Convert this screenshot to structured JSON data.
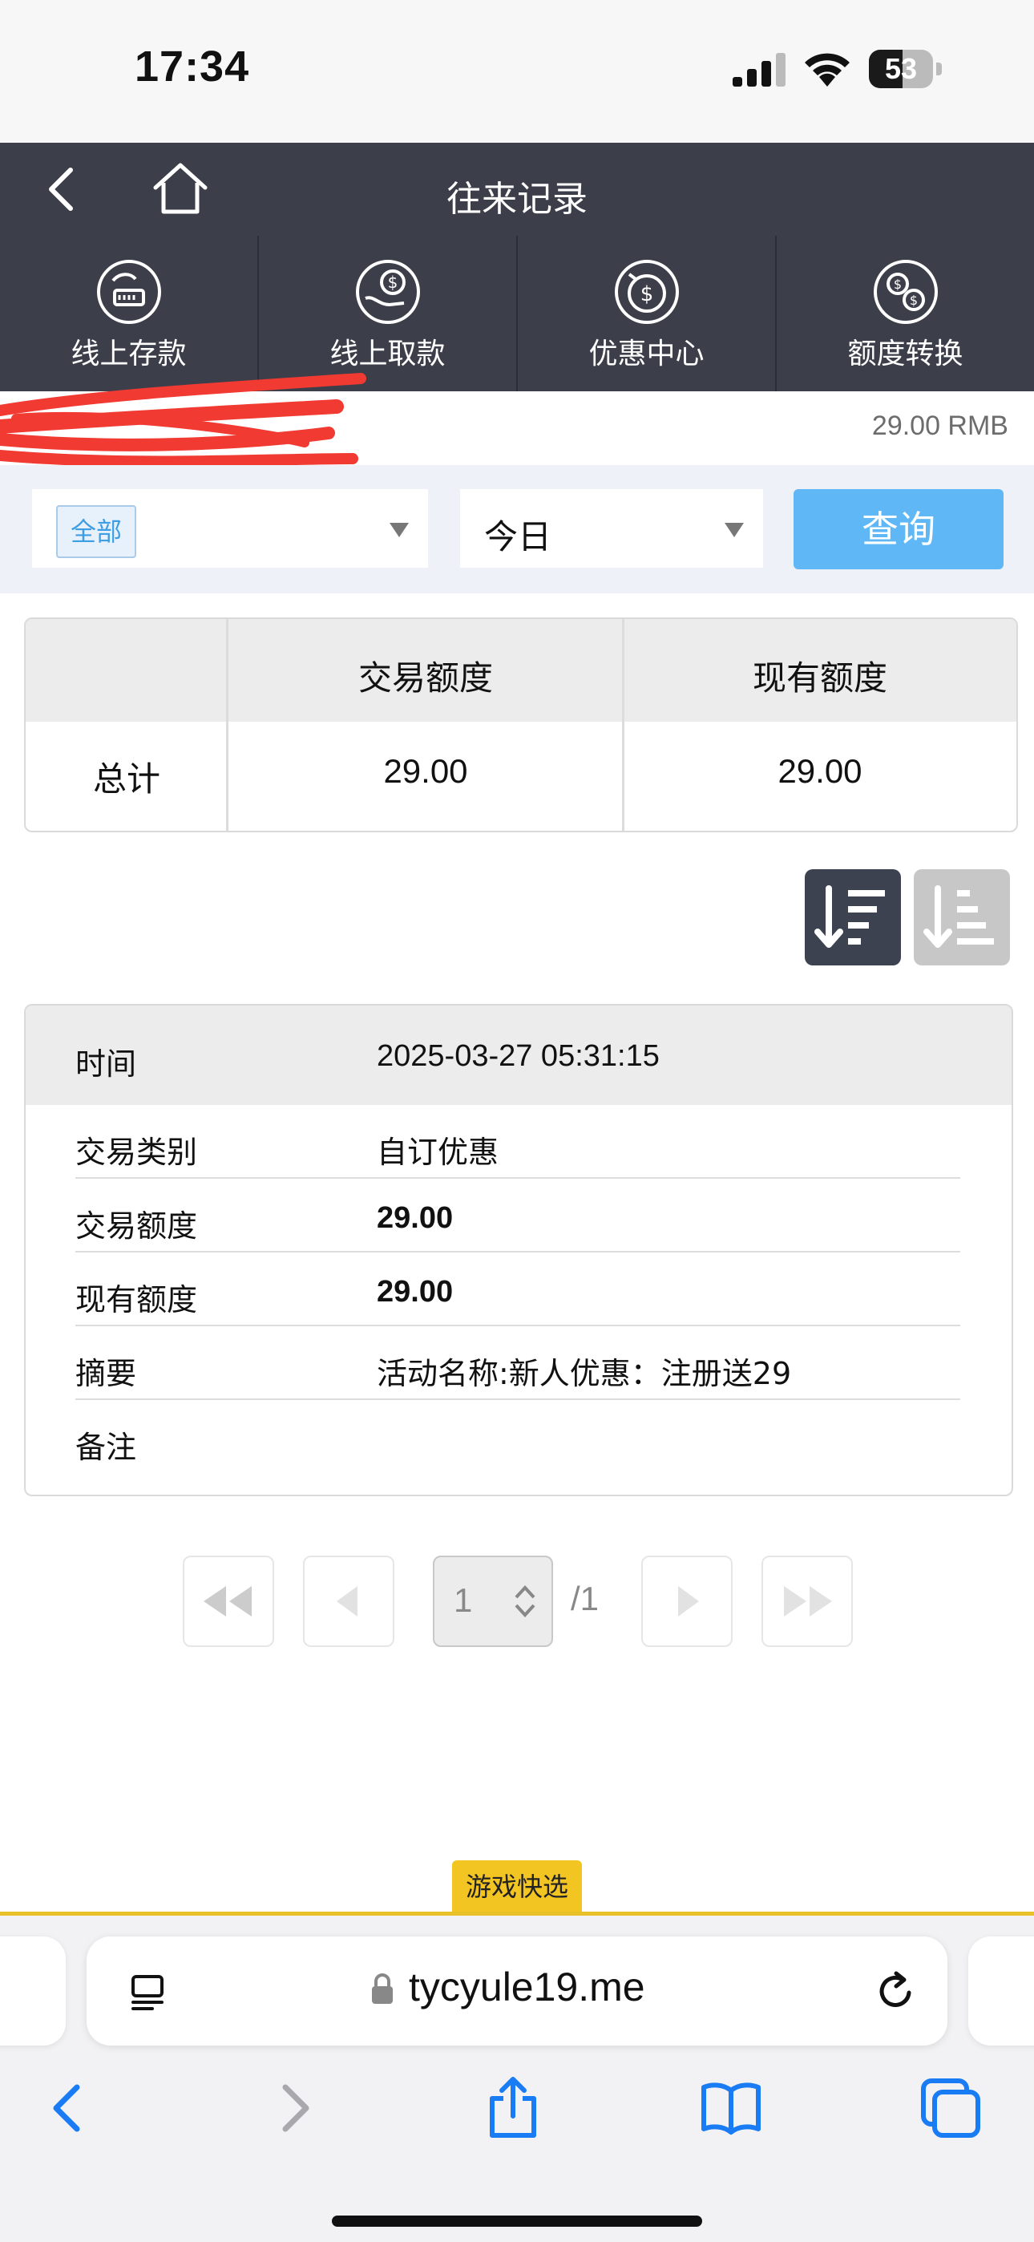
{
  "status_bar": {
    "time": "17:34",
    "battery_percent": "53",
    "battery_level": 0.53
  },
  "nav": {
    "title": "往来记录"
  },
  "quick_menu": [
    {
      "label": "线上存款",
      "icon": "deposit-icon"
    },
    {
      "label": "线上取款",
      "icon": "withdraw-icon"
    },
    {
      "label": "优惠中心",
      "icon": "promotion-icon"
    },
    {
      "label": "额度转换",
      "icon": "transfer-icon"
    }
  ],
  "balance": {
    "value": "29.00 RMB"
  },
  "filters": {
    "type_selected": "全部",
    "date_selected": "今日",
    "query_label": "查询"
  },
  "summary": {
    "headers": [
      "",
      "交易额度",
      "现有额度"
    ],
    "row_label": "总计",
    "transaction_amount": "29.00",
    "current_amount": "29.00"
  },
  "record": {
    "time_label": "时间",
    "time_value": "2025-03-27 05:31:15",
    "rows": [
      {
        "label": "交易类别",
        "value": "自订优惠"
      },
      {
        "label": "交易额度",
        "value": "29.00"
      },
      {
        "label": "现有额度",
        "value": "29.00"
      },
      {
        "label": "摘要",
        "value": "活动名称:新人优惠：注册送29"
      },
      {
        "label": "备注",
        "value": ""
      }
    ]
  },
  "pagination": {
    "current": "1",
    "total": "/1"
  },
  "game_bar": {
    "label": "游戏快选"
  },
  "browser": {
    "url": "tycyule19.me"
  },
  "colors": {
    "nav_bg": "#3c3f4a",
    "query_btn": "#5fb8f5",
    "game_accent": "#f3c522",
    "ios_blue": "#1a7cf5"
  }
}
